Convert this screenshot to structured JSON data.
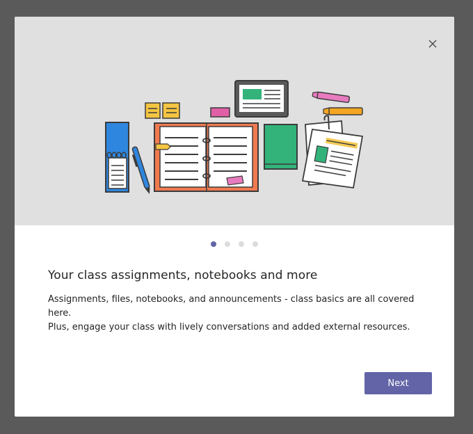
{
  "dialog": {
    "close_icon": "close-icon",
    "illustration_icon": "class-supplies-illustration",
    "carousel": {
      "pages": 4,
      "active_index": 0,
      "active_color": "#6264a7",
      "inactive_color": "#dcdcdc"
    },
    "title": "Your class assignments, notebooks and more",
    "description_line1": "Assignments, files, notebooks, and announcements - class basics are all covered here.",
    "description_line2": "Plus, engage your class with lively conversations and added external resources.",
    "next_label": "Next",
    "accent_color": "#6264a7"
  }
}
